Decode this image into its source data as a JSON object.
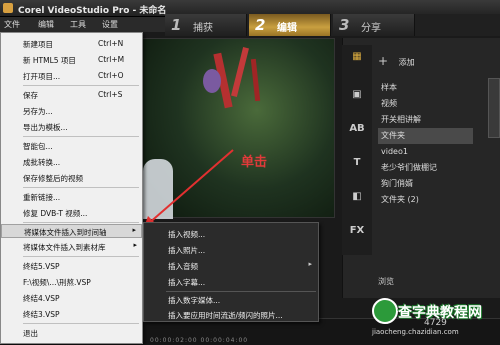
{
  "app": {
    "title": "Corel VideoStudio Pro - 未命名"
  },
  "menubar": [
    "文件",
    "编辑",
    "工具",
    "设置"
  ],
  "steps": [
    {
      "num": "1",
      "label": "捕获"
    },
    {
      "num": "2",
      "label": "编辑"
    },
    {
      "num": "3",
      "label": "分享"
    }
  ],
  "preview": {
    "annotation": "单击"
  },
  "file_menu": {
    "items": [
      {
        "label": "新建项目",
        "shortcut": "Ctrl+N"
      },
      {
        "label": "新 HTML5 项目",
        "shortcut": "Ctrl+M"
      },
      {
        "label": "打开项目...",
        "shortcut": "Ctrl+O"
      },
      {
        "label": "保存",
        "shortcut": "Ctrl+S"
      },
      {
        "label": "另存为...",
        "shortcut": ""
      },
      {
        "label": "导出为模板...",
        "shortcut": ""
      },
      {
        "label": "智能包...",
        "shortcut": ""
      },
      {
        "label": "成批转换...",
        "shortcut": ""
      },
      {
        "label": "保存修整后的视频",
        "shortcut": ""
      },
      {
        "label": "重新链接...",
        "shortcut": ""
      },
      {
        "label": "修复 DVB-T 视频...",
        "shortcut": ""
      },
      {
        "label": "将媒体文件插入到时间轴",
        "shortcut": ""
      },
      {
        "label": "将媒体文件插入到素材库",
        "shortcut": ""
      },
      {
        "label": "终结5.VSP",
        "shortcut": ""
      },
      {
        "label": "F:\\视频\\...\\刑熬.VSP",
        "shortcut": ""
      },
      {
        "label": "终结4.VSP",
        "shortcut": ""
      },
      {
        "label": "终结3.VSP",
        "shortcut": ""
      },
      {
        "label": "退出",
        "shortcut": ""
      }
    ]
  },
  "insert_submenu": {
    "items": [
      "插入视频...",
      "插入照片...",
      "插入音频",
      "插入字幕...",
      "插入数字媒体...",
      "插入要应用时间流逝/频闪的照片..."
    ]
  },
  "library": {
    "add_label": "添加",
    "items": [
      "样本",
      "视频",
      "开关相讲解",
      "文件夹",
      "video1",
      "老少爷们做棚记",
      "狗门俏婿",
      "文件夹 (2)"
    ],
    "selected_index": 3,
    "browse_label": "浏览"
  },
  "tools": [
    "media-icon",
    "instant-project-icon",
    "transition-icon",
    "title-icon",
    "graphic-icon",
    "fx-icon"
  ],
  "timeline": {
    "ruler": "00:00:02:00   00:00:04:00"
  },
  "watermark": {
    "brand": "查字典教程网",
    "site": "jiaocheng.chazidian.com",
    "code": "4729"
  }
}
